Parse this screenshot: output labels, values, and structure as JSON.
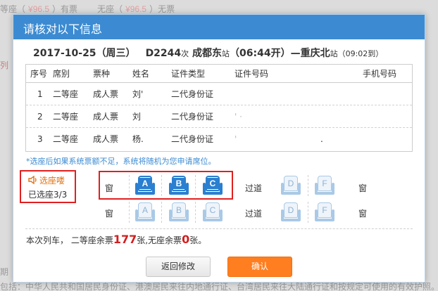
{
  "background": {
    "top_line_parts": [
      "等座（",
      "¥96.5",
      "）有票",
      "无座（",
      "¥96.5",
      "）无票"
    ],
    "left_mark": "列",
    "bottom_line1": "期",
    "bottom_line2": "包括：中华人民共和国居民身份证、港澳居民来往内地通行证、台湾居民来往大陆通行证和按规定可使用的有效护照。"
  },
  "modal": {
    "title": "请核对以下信息",
    "trip": {
      "date": "2017-10-25",
      "weekday": "（周三）",
      "train": "D2244",
      "train_suffix": "次",
      "from": "成都东",
      "from_suffix": "站",
      "depart": "（06:44开）",
      "arrow": "—",
      "to": "重庆北",
      "to_suffix": "站",
      "arrive": "（09:02到）"
    },
    "table": {
      "headers": [
        "序号",
        "席别",
        "票种",
        "姓名",
        "证件类型",
        "证件号码",
        "手机号码"
      ],
      "rows": [
        {
          "no": "1",
          "seat": "二等座",
          "ticket": "成人票",
          "name": "刘'",
          "id_type": "二代身份证",
          "id_no": "",
          "phone": ""
        },
        {
          "no": "2",
          "seat": "二等座",
          "ticket": "成人票",
          "name": "刘",
          "id_type": "二代身份证",
          "id_no": "' ·",
          "phone": ""
        },
        {
          "no": "3",
          "seat": "二等座",
          "ticket": "成人票",
          "name": "杨.",
          "id_type": "二代身份证",
          "id_no": "'",
          "phone": "."
        }
      ]
    },
    "note": "*选座后如果系统票额不足，系统将随机为您申请席位。",
    "seat_status": {
      "title": "选座喽",
      "selected": "已选座3/3"
    },
    "seat_rows": [
      {
        "left_label": "窗",
        "aisle_label": "过道",
        "right_label": "窗",
        "seats": [
          {
            "id": "A",
            "selected": true
          },
          {
            "id": "B",
            "selected": true
          },
          {
            "id": "C",
            "selected": true
          },
          {
            "id": "D",
            "selected": false
          },
          {
            "id": "F",
            "selected": false
          }
        ]
      },
      {
        "left_label": "窗",
        "aisle_label": "过道",
        "right_label": "窗",
        "seats": [
          {
            "id": "A",
            "selected": false
          },
          {
            "id": "B",
            "selected": false
          },
          {
            "id": "C",
            "selected": false
          },
          {
            "id": "D",
            "selected": false
          },
          {
            "id": "F",
            "selected": false
          }
        ]
      }
    ],
    "remain": {
      "prefix": "本次列车，  二等座余票",
      "second_count": "177",
      "mid": "张,无座余票",
      "noseat_count": "0",
      "suffix": "张。"
    },
    "buttons": {
      "back": "返回修改",
      "confirm": "确认"
    },
    "colors": {
      "header": "#3c8bd2",
      "selected_seat": "#2a7fd0",
      "confirm_button": "#ff7e1f",
      "highlight_border": "#e02020",
      "count_red": "#d21e1e"
    }
  }
}
